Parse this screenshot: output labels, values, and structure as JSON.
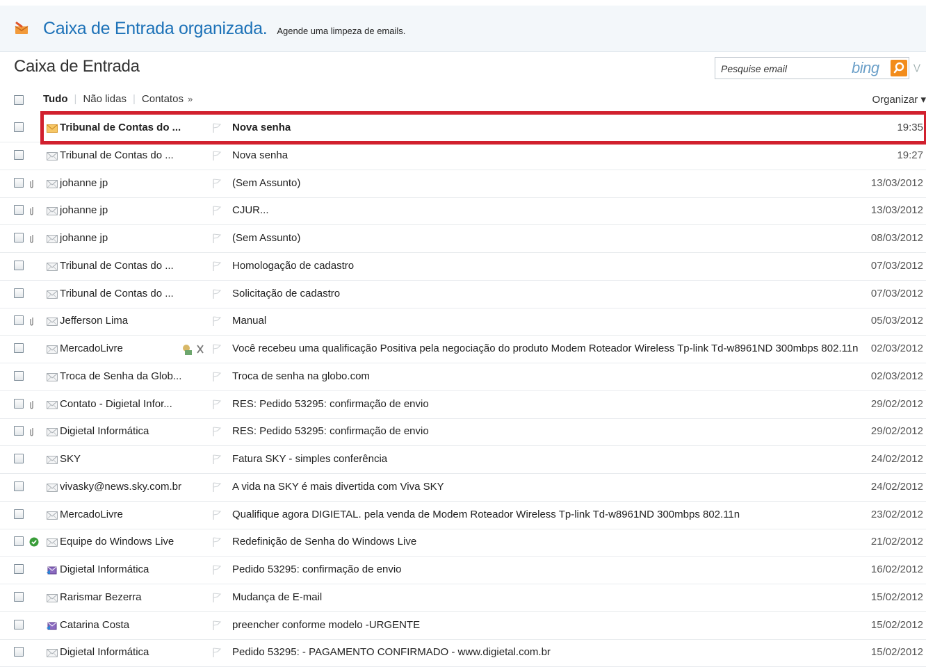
{
  "banner": {
    "title": "Caixa de Entrada organizada.",
    "subtitle": "Agende uma limpeza de emails.",
    "icon": "broom-icon"
  },
  "header": {
    "title": "Caixa de Entrada",
    "search_placeholder": "Pesquise email",
    "search_brand": "bing"
  },
  "filters": {
    "all": "Tudo",
    "unread": "Não lidas",
    "contacts": "Contatos",
    "more": "»",
    "organize": "Organizar ▾"
  },
  "emails": [
    {
      "sender": "Tribunal de Contas do ...",
      "subject": "Nova senha",
      "date": "19:35",
      "unread": true,
      "attachment": false,
      "icon": "envelope-unread-icon"
    },
    {
      "sender": "Tribunal de Contas do ...",
      "subject": "Nova senha",
      "date": "19:27",
      "unread": false,
      "attachment": false,
      "icon": "envelope-read-icon"
    },
    {
      "sender": "johanne jp",
      "subject": "(Sem Assunto)",
      "date": "13/03/2012",
      "unread": false,
      "attachment": true,
      "icon": "envelope-read-icon"
    },
    {
      "sender": "johanne jp",
      "subject": "CJUR...",
      "date": "13/03/2012",
      "unread": false,
      "attachment": true,
      "icon": "envelope-read-icon"
    },
    {
      "sender": "johanne jp",
      "subject": "(Sem Assunto)",
      "date": "08/03/2012",
      "unread": false,
      "attachment": true,
      "icon": "envelope-read-icon"
    },
    {
      "sender": "Tribunal de Contas do ...",
      "subject": "Homologação de cadastro",
      "date": "07/03/2012",
      "unread": false,
      "attachment": false,
      "icon": "envelope-read-icon"
    },
    {
      "sender": "Tribunal de Contas do ...",
      "subject": "Solicitação de cadastro",
      "date": "07/03/2012",
      "unread": false,
      "attachment": false,
      "icon": "envelope-read-icon"
    },
    {
      "sender": "Jefferson Lima",
      "subject": "Manual",
      "date": "05/03/2012",
      "unread": false,
      "attachment": true,
      "icon": "envelope-read-icon"
    },
    {
      "sender": "MercadoLivre",
      "subject": "Você recebeu uma qualificação Positiva pela negociação do produto Modem Roteador Wireless Tp-link Td-w8961ND 300mbps 802.11n",
      "date": "02/03/2012",
      "unread": false,
      "attachment": false,
      "icon": "envelope-read-icon",
      "hover_actions": true
    },
    {
      "sender": "Troca de Senha da Glob...",
      "subject": "Troca de senha na globo.com",
      "date": "02/03/2012",
      "unread": false,
      "attachment": false,
      "icon": "envelope-read-icon"
    },
    {
      "sender": "Contato - Digietal Infor...",
      "subject": "RES: Pedido 53295: confirmação de envio",
      "date": "29/02/2012",
      "unread": false,
      "attachment": true,
      "icon": "envelope-read-icon"
    },
    {
      "sender": "Digietal Informática",
      "subject": "RES: Pedido 53295: confirmação de envio",
      "date": "29/02/2012",
      "unread": false,
      "attachment": true,
      "icon": "envelope-read-icon"
    },
    {
      "sender": "SKY",
      "subject": "Fatura SKY - simples conferência",
      "date": "24/02/2012",
      "unread": false,
      "attachment": false,
      "icon": "envelope-read-icon"
    },
    {
      "sender": "vivasky@news.sky.com.br",
      "subject": "A vida na SKY é mais divertida com Viva SKY",
      "date": "24/02/2012",
      "unread": false,
      "attachment": false,
      "icon": "envelope-read-icon"
    },
    {
      "sender": "MercadoLivre",
      "subject": "Qualifique agora DIGIETAL. pela venda de Modem Roteador Wireless Tp-link Td-w8961ND 300mbps 802.11n",
      "date": "23/02/2012",
      "unread": false,
      "attachment": false,
      "icon": "envelope-read-icon"
    },
    {
      "sender": "Equipe do Windows Live",
      "subject": "Redefinição de Senha do Windows Live",
      "date": "21/02/2012",
      "unread": false,
      "attachment": false,
      "icon": "envelope-read-icon",
      "verified": true
    },
    {
      "sender": "Digietal Informática",
      "subject": "Pedido 53295: confirmação de envio",
      "date": "16/02/2012",
      "unread": false,
      "attachment": false,
      "icon": "forward-icon"
    },
    {
      "sender": "Rarismar Bezerra",
      "subject": "Mudança de E-mail",
      "date": "15/02/2012",
      "unread": false,
      "attachment": false,
      "icon": "envelope-read-icon"
    },
    {
      "sender": "Catarina Costa",
      "subject": "preencher conforme modelo -URGENTE",
      "date": "15/02/2012",
      "unread": false,
      "attachment": false,
      "icon": "forward-icon"
    },
    {
      "sender": "Digietal Informática",
      "subject": "Pedido 53295: - PAGAMENTO CONFIRMADO - www.digietal.com.br",
      "date": "15/02/2012",
      "unread": false,
      "attachment": false,
      "icon": "envelope-read-icon"
    }
  ]
}
